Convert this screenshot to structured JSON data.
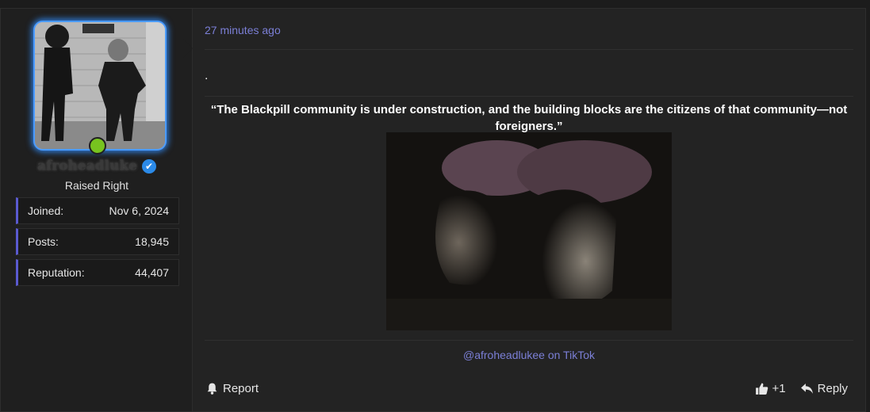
{
  "user": {
    "username": "afroheadluke",
    "title": "Raised Right",
    "stats": [
      {
        "label": "Joined:",
        "value": "Nov 6, 2024"
      },
      {
        "label": "Posts:",
        "value": "18,945"
      },
      {
        "label": "Reputation:",
        "value": "44,407"
      }
    ],
    "verified_icon": "check-icon",
    "online_color": "#77c41f"
  },
  "post": {
    "time": "27 minutes ago",
    "first_line": ".",
    "quote": "“The Blackpill community is under construction, and the building blocks are the citizens of that community—not foreigners.”",
    "source": "@afroheadlukee on TikTok"
  },
  "actions": {
    "report": "Report",
    "like_count": "+1",
    "reply": "Reply"
  },
  "colors": {
    "link": "#7b7fd6",
    "accent_border": "#5a5ad0"
  }
}
